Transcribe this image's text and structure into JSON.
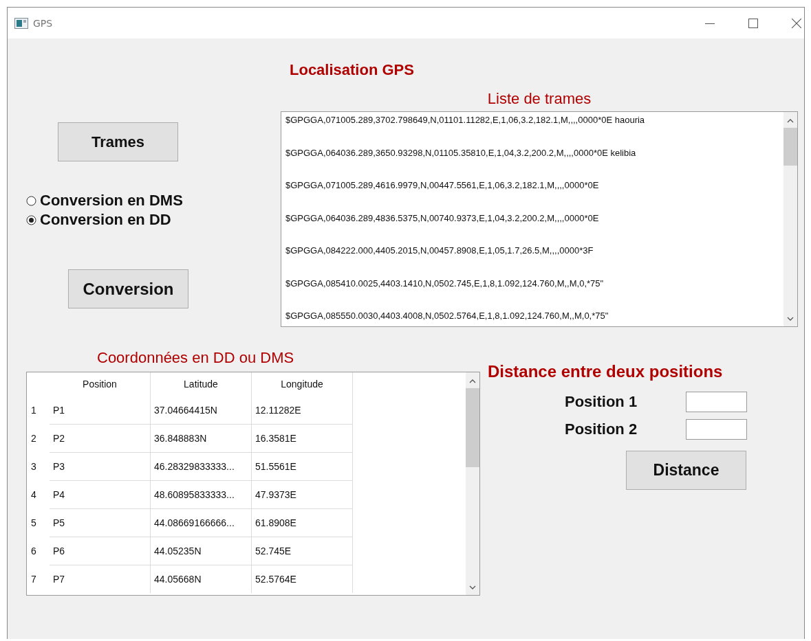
{
  "window": {
    "title": "GPS"
  },
  "heading": "Localisation GPS",
  "trames_button": "Trames",
  "conversion_options": [
    {
      "label": "Conversion en DMS",
      "selected": false
    },
    {
      "label": "Conversion en DD",
      "selected": true
    }
  ],
  "conversion_button": "Conversion",
  "frames_list": {
    "label": "Liste de trames",
    "items": [
      "$GPGGA,071005.289,3702.798649,N,01101.11282,E,1,06,3.2,182.1,M,,,,0000*0E haouria",
      "$GPGGA,064036.289,3650.93298,N,01105.35810,E,1,04,3.2,200.2,M,,,,0000*0E kelibia",
      "$GPGGA,071005.289,4616.9979,N,00447.5561,E,1,06,3.2,182.1,M,,,,0000*0E",
      "$GPGGA,064036.289,4836.5375,N,00740.9373,E,1,04,3.2,200.2,M,,,,0000*0E",
      "$GPGGA,084222.000,4405.2015,N,00457.8908,E,1,05,1.7,26.5,M,,,,0000*3F",
      "$GPGGA,085410.0025,4403.1410,N,0502.745,E,1,8,1.092,124.760,M,,M,0,*75\"",
      "$GPGGA,085550.0030,4403.4008,N,0502.5764,E,1,8,1.092,124.760,M,,M,0,*75\""
    ]
  },
  "coordinates": {
    "label": "Coordonnées en DD ou DMS",
    "columns": [
      "Position",
      "Latitude",
      "Longitude"
    ],
    "rows": [
      {
        "index": "1",
        "cells": [
          "P1",
          "37.04664415N",
          "12.11282E"
        ]
      },
      {
        "index": "2",
        "cells": [
          "P2",
          "36.848883N",
          "16.3581E"
        ]
      },
      {
        "index": "3",
        "cells": [
          "P3",
          "46.28329833333...",
          "51.5561E"
        ]
      },
      {
        "index": "4",
        "cells": [
          "P4",
          "48.60895833333...",
          "47.9373E"
        ]
      },
      {
        "index": "5",
        "cells": [
          "P5",
          "44.08669166666...",
          "61.8908E"
        ]
      },
      {
        "index": "6",
        "cells": [
          "P6",
          "44.05235N",
          "52.745E"
        ]
      },
      {
        "index": "7",
        "cells": [
          "P7",
          "44.05668N",
          "52.5764E"
        ]
      }
    ]
  },
  "distance": {
    "heading": "Distance entre deux positions",
    "fields": [
      {
        "label": "Position 1"
      },
      {
        "label": "Position 2"
      }
    ],
    "button": "Distance"
  }
}
